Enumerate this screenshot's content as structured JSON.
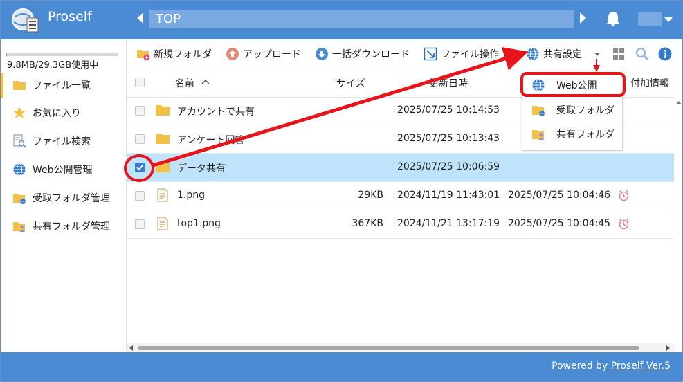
{
  "app": {
    "brand": "Proself",
    "path": "TOP"
  },
  "sidebar": {
    "usage_text": "9.8MB/29.3GB使用中",
    "usage_fraction": 0.0003,
    "items": [
      {
        "label": "ファイル一覧",
        "icon": "folder-icon",
        "active": true
      },
      {
        "label": "お気に入り",
        "icon": "star-icon"
      },
      {
        "label": "ファイル検索",
        "icon": "file-search-icon"
      },
      {
        "label": "Web公開管理",
        "icon": "globe-icon"
      },
      {
        "label": "受取フォルダ管理",
        "icon": "receive-folder-icon"
      },
      {
        "label": "共有フォルダ管理",
        "icon": "shared-folder-icon"
      }
    ]
  },
  "toolbar": {
    "new_folder": "新規フォルダ",
    "upload": "アップロード",
    "bulk_download": "一括ダウンロード",
    "file_ops": "ファイル操作",
    "share_settings": "共有設定"
  },
  "table": {
    "headers": {
      "name": "名前",
      "size": "サイズ",
      "updated": "更新日時",
      "extra": "付加情報"
    },
    "rows": [
      {
        "type": "folder",
        "name": "アカウントで共有",
        "size": "",
        "updated": "2025/07/25 10:14:53",
        "expires": "",
        "selected": false
      },
      {
        "type": "folder",
        "name": "アンケート回答",
        "size": "",
        "updated": "2025/07/25 10:13:43",
        "expires": "",
        "selected": false
      },
      {
        "type": "folder",
        "name": "データ共有",
        "size": "",
        "updated": "2025/07/25 10:06:59",
        "expires": "",
        "selected": true
      },
      {
        "type": "file",
        "name": "1.png",
        "size": "29KB",
        "updated": "2024/11/19 11:43:01",
        "expires": "2025/07/25 10:04:46",
        "selected": false
      },
      {
        "type": "file",
        "name": "top1.png",
        "size": "367KB",
        "updated": "2024/11/21 13:17:19",
        "expires": "2025/07/25 10:04:45",
        "selected": false
      }
    ]
  },
  "share_menu": {
    "items": [
      {
        "label": "Web公開",
        "icon": "globe-icon"
      },
      {
        "label": "受取フォルダ",
        "icon": "receive-folder-icon"
      },
      {
        "label": "共有フォルダ",
        "icon": "shared-folder-icon"
      }
    ]
  },
  "footer": {
    "prefix": "Powered by ",
    "link": "Proself Ver.5"
  },
  "colors": {
    "header": "#4a8bd4",
    "selected_row": "#bee3fa",
    "annotation_red": "#e8141c"
  }
}
